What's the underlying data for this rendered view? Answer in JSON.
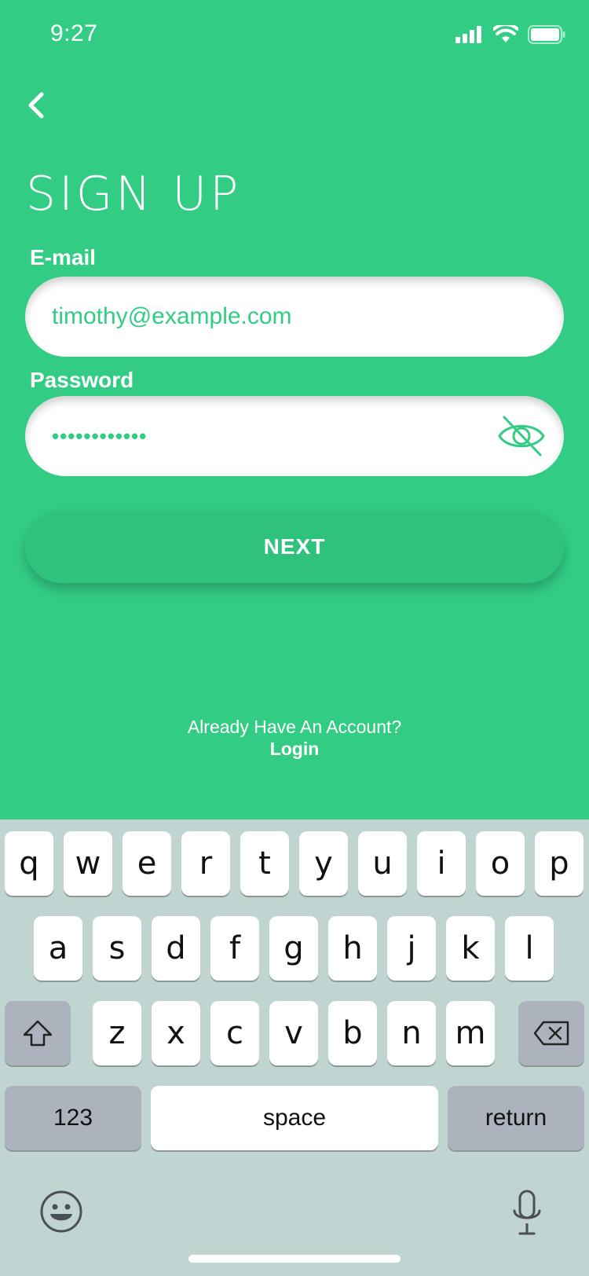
{
  "status_bar": {
    "time": "9:27"
  },
  "header": {
    "title": "SIGN UP"
  },
  "form": {
    "email_label": "E-mail",
    "email_value": "timothy@example.com",
    "password_label": "Password",
    "password_value": "••••••••••••"
  },
  "actions": {
    "next_label": "NEXT",
    "account_prompt": "Already Have An Account?",
    "login_label": "Login"
  },
  "keyboard": {
    "row1": [
      "q",
      "w",
      "e",
      "r",
      "t",
      "y",
      "u",
      "i",
      "o",
      "p"
    ],
    "row2": [
      "a",
      "s",
      "d",
      "f",
      "g",
      "h",
      "j",
      "k",
      "l"
    ],
    "row3": [
      "z",
      "x",
      "c",
      "v",
      "b",
      "n",
      "m"
    ],
    "numbers_label": "123",
    "space_label": "space",
    "return_label": "return"
  },
  "colors": {
    "brand": "#33cc85",
    "keyboard_bg": "#c0d4d1"
  }
}
